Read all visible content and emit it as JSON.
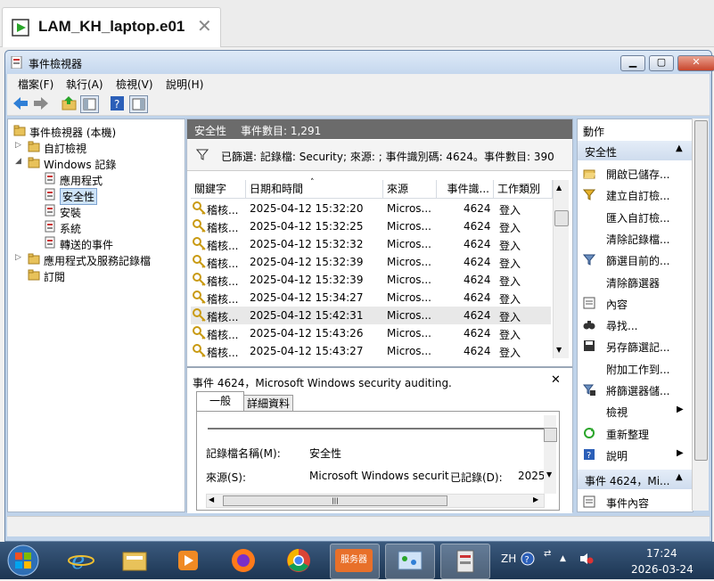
{
  "browser_tab": {
    "title": "LAM_KH_laptop.e01",
    "close": "✕"
  },
  "window": {
    "title": "事件檢視器",
    "min": "▁",
    "max": "▢",
    "close": "✕"
  },
  "menu": [
    "檔案(F)",
    "執行(A)",
    "檢視(V)",
    "說明(H)"
  ],
  "tree": [
    {
      "label": "事件檢視器 (本機)",
      "exp": "",
      "indent": 0,
      "selected": false
    },
    {
      "label": "自訂檢視",
      "exp": "▷",
      "indent": 1,
      "selected": false
    },
    {
      "label": "Windows 記錄",
      "exp": "◢",
      "indent": 1,
      "selected": false
    },
    {
      "label": "應用程式",
      "exp": "",
      "indent": 2,
      "selected": false
    },
    {
      "label": "安全性",
      "exp": "",
      "indent": 2,
      "selected": true
    },
    {
      "label": "安裝",
      "exp": "",
      "indent": 2,
      "selected": false
    },
    {
      "label": "系統",
      "exp": "",
      "indent": 2,
      "selected": false
    },
    {
      "label": "轉送的事件",
      "exp": "",
      "indent": 2,
      "selected": false
    },
    {
      "label": "應用程式及服務記錄檔",
      "exp": "▷",
      "indent": 1,
      "selected": false
    },
    {
      "label": "訂閱",
      "exp": "",
      "indent": 1,
      "selected": false
    }
  ],
  "center": {
    "header_name": "安全性",
    "header_count": "事件數目: 1,291",
    "filter_text": "已篩選: 記錄檔: Security; 來源: ; 事件識別碼: 4624。事件數目: 390",
    "columns": [
      "關鍵字",
      "日期和時間",
      "來源",
      "事件識...",
      "工作類別"
    ],
    "rows": [
      {
        "kw": "稽核...",
        "dt": "2025-04-12 15:32:20",
        "src": "Micros...",
        "id": "4624",
        "cat": "登入",
        "sel": false
      },
      {
        "kw": "稽核...",
        "dt": "2025-04-12 15:32:25",
        "src": "Micros...",
        "id": "4624",
        "cat": "登入",
        "sel": false
      },
      {
        "kw": "稽核...",
        "dt": "2025-04-12 15:32:32",
        "src": "Micros...",
        "id": "4624",
        "cat": "登入",
        "sel": false
      },
      {
        "kw": "稽核...",
        "dt": "2025-04-12 15:32:39",
        "src": "Micros...",
        "id": "4624",
        "cat": "登入",
        "sel": false
      },
      {
        "kw": "稽核...",
        "dt": "2025-04-12 15:32:39",
        "src": "Micros...",
        "id": "4624",
        "cat": "登入",
        "sel": false
      },
      {
        "kw": "稽核...",
        "dt": "2025-04-12 15:34:27",
        "src": "Micros...",
        "id": "4624",
        "cat": "登入",
        "sel": false
      },
      {
        "kw": "稽核...",
        "dt": "2025-04-12 15:42:31",
        "src": "Micros...",
        "id": "4624",
        "cat": "登入",
        "sel": true
      },
      {
        "kw": "稽核...",
        "dt": "2025-04-12 15:43:26",
        "src": "Micros...",
        "id": "4624",
        "cat": "登入",
        "sel": false
      },
      {
        "kw": "稽核...",
        "dt": "2025-04-12 15:43:27",
        "src": "Micros...",
        "id": "4624",
        "cat": "登入",
        "sel": false
      }
    ]
  },
  "detail": {
    "title": "事件 4624，Microsoft Windows security auditing.",
    "close": "✕",
    "tabs": [
      "一般",
      "詳細資料"
    ],
    "log_name_label": "記錄檔名稱(M):",
    "log_name_value": "安全性",
    "source_label": "來源(S):",
    "source_value": "Microsoft Windows securit",
    "logged_label": "已記錄(D):",
    "logged_value": "2025"
  },
  "actions": {
    "title": "動作",
    "section1": "安全性",
    "items": [
      {
        "label": "開啟已儲存...",
        "icon": "folder-open-icon",
        "arrow": false
      },
      {
        "label": "建立自訂檢...",
        "icon": "filter-create-icon",
        "arrow": false
      },
      {
        "label": "匯入自訂檢...",
        "icon": "",
        "arrow": false
      },
      {
        "label": "清除記錄檔...",
        "icon": "",
        "arrow": false
      },
      {
        "label": "篩選目前的...",
        "icon": "filter-icon",
        "arrow": false
      },
      {
        "label": "清除篩選器",
        "icon": "",
        "arrow": false
      },
      {
        "label": "內容",
        "icon": "properties-icon",
        "arrow": false
      },
      {
        "label": "尋找...",
        "icon": "binoculars-icon",
        "arrow": false
      },
      {
        "label": "另存篩選記...",
        "icon": "save-icon",
        "arrow": false
      },
      {
        "label": "附加工作到...",
        "icon": "",
        "arrow": false
      },
      {
        "label": "將篩選器儲...",
        "icon": "filter-save-icon",
        "arrow": false
      },
      {
        "label": "檢視",
        "icon": "",
        "arrow": true
      },
      {
        "label": "重新整理",
        "icon": "refresh-icon",
        "arrow": false
      },
      {
        "label": "說明",
        "icon": "help-icon",
        "arrow": true
      }
    ],
    "section2": "事件 4624，Mi...",
    "items2": [
      {
        "label": "事件內容",
        "icon": "event-properties-icon"
      }
    ]
  },
  "taskbar": {
    "server_label": "服务器",
    "lang": "ZH",
    "time": "17:24",
    "date": "2026-03-24"
  },
  "colors": {
    "accent": "#1a7fd0",
    "header_gray": "#6b6b6b",
    "section_bg": "#cfdcee"
  }
}
